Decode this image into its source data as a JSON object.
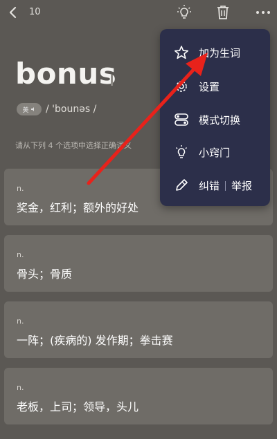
{
  "header": {
    "count": "10",
    "icons": [
      "back-icon",
      "bulb-icon",
      "trash-icon",
      "more-icon"
    ]
  },
  "word": {
    "text": "bonus",
    "accent_label": "美",
    "phonetic": "/ 'bounəs /"
  },
  "instruction": "请从下列 4 个选项中选择正确词义",
  "options": [
    {
      "pos": "n.",
      "definition": "奖金，红利；额外的好处"
    },
    {
      "pos": "n.",
      "definition": "骨头；骨质"
    },
    {
      "pos": "n.",
      "definition": "一阵；(疾病的) 发作期；拳击赛"
    },
    {
      "pos": "n.",
      "definition": "老板，上司；领导，头儿"
    }
  ],
  "menu": {
    "items": [
      {
        "label": "加为生词",
        "icon": "star-icon"
      },
      {
        "label": "设置",
        "icon": "settings-icon"
      },
      {
        "label": "模式切换",
        "icon": "mode-switch-icon"
      },
      {
        "label": "小窍门",
        "icon": "bulb-icon"
      },
      {
        "label": "纠错",
        "label2": "举报",
        "icon": "pen-icon"
      }
    ]
  },
  "colors": {
    "background": "#5b5854",
    "card": "#6f6c67",
    "menu": "#2c2f4a",
    "arrow": "#e8221b"
  }
}
